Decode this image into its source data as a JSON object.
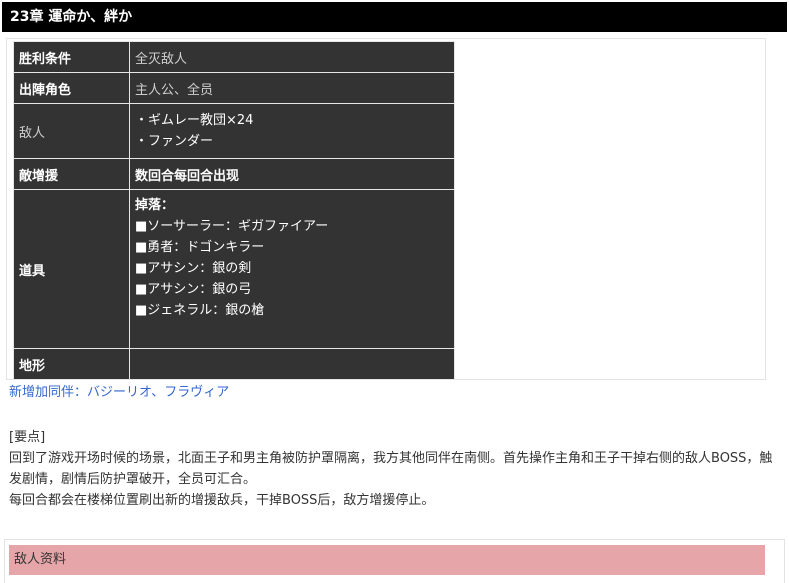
{
  "chapter": {
    "title": "23章 運命か、絆か"
  },
  "info_table": {
    "victory_label": "胜利条件",
    "victory_value": "全灭敌人",
    "deploy_label": "出陣角色",
    "deploy_value": "主人公、全员",
    "enemy_label": "敌人",
    "enemy_lines": [
      "・ギムレー教団×24",
      "・ファンダー"
    ],
    "reinforce_label": "敵增援",
    "reinforce_value": "数回合每回合出现",
    "items_label": "道具",
    "items_lines": [
      "掉落：",
      "■ソーサーラー：ギガファイアー",
      "■勇者：ドゴンキラー",
      "■アサシン：銀の剣",
      "■アサシン：銀の弓",
      "■ジェネラル：銀の槍"
    ],
    "terrain_label": "地形",
    "terrain_value": ""
  },
  "allies": {
    "text": "新增加同伴：バジーリオ、フラヴィア"
  },
  "notes": {
    "heading": "[要点]",
    "paragraph1": "回到了游戏开场时候的场景，北面王子和男主角被防护罩隔离，我方其他同伴在南侧。首先操作主角和王子干掉右侧的敌人BOSS，触发剧情，剧情后防护罩破开，全员可汇合。",
    "paragraph2": "每回合都会在楼梯位置刷出新的增援敌兵，干掉BOSS后，敌方增援停止。"
  },
  "section": {
    "title": "敌人资料"
  },
  "colors": {
    "chapter_bar_bg": "#000000",
    "table_bg": "#333333",
    "link_blue": "#3366cc",
    "section_bar_bg": "#e6a5a9"
  }
}
